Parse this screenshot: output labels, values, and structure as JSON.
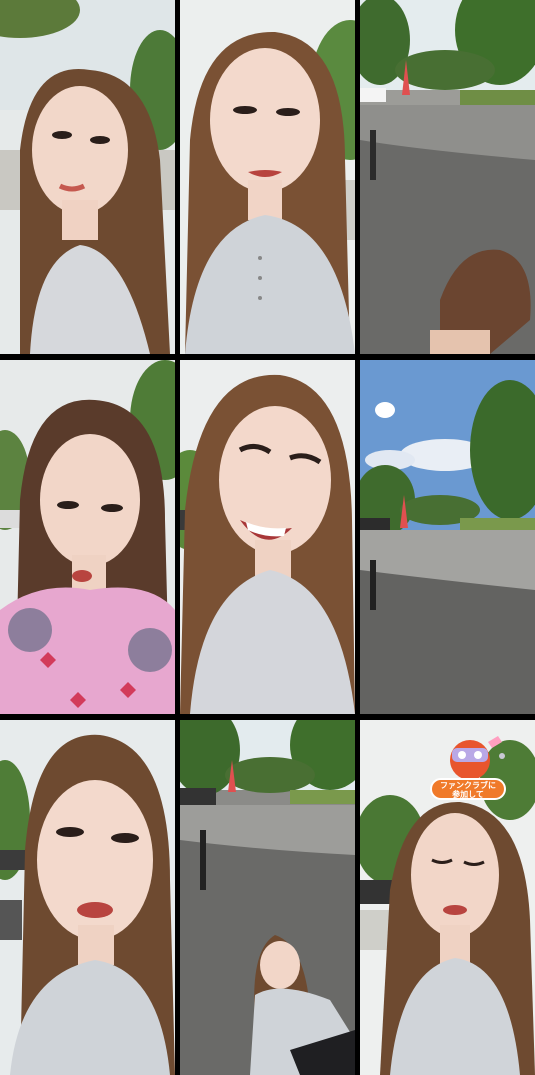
{
  "layout": {
    "columns": 3,
    "rows": 3
  },
  "tiles": [
    {
      "id": 1,
      "subject": "woman-selfie"
    },
    {
      "id": 2,
      "subject": "woman-selfie"
    },
    {
      "id": 3,
      "subject": "park-path-head-bottom"
    },
    {
      "id": 4,
      "subject": "woman-pink-shirt"
    },
    {
      "id": 5,
      "subject": "woman-smiling"
    },
    {
      "id": 6,
      "subject": "park-path-sky"
    },
    {
      "id": 7,
      "subject": "woman-selfie-closeup"
    },
    {
      "id": 8,
      "subject": "woman-sitting-on-path"
    },
    {
      "id": 9,
      "subject": "woman-eyes-closed"
    }
  ],
  "fanclub_badge": {
    "line1": "ファンクラブに",
    "line2": "参加して"
  }
}
